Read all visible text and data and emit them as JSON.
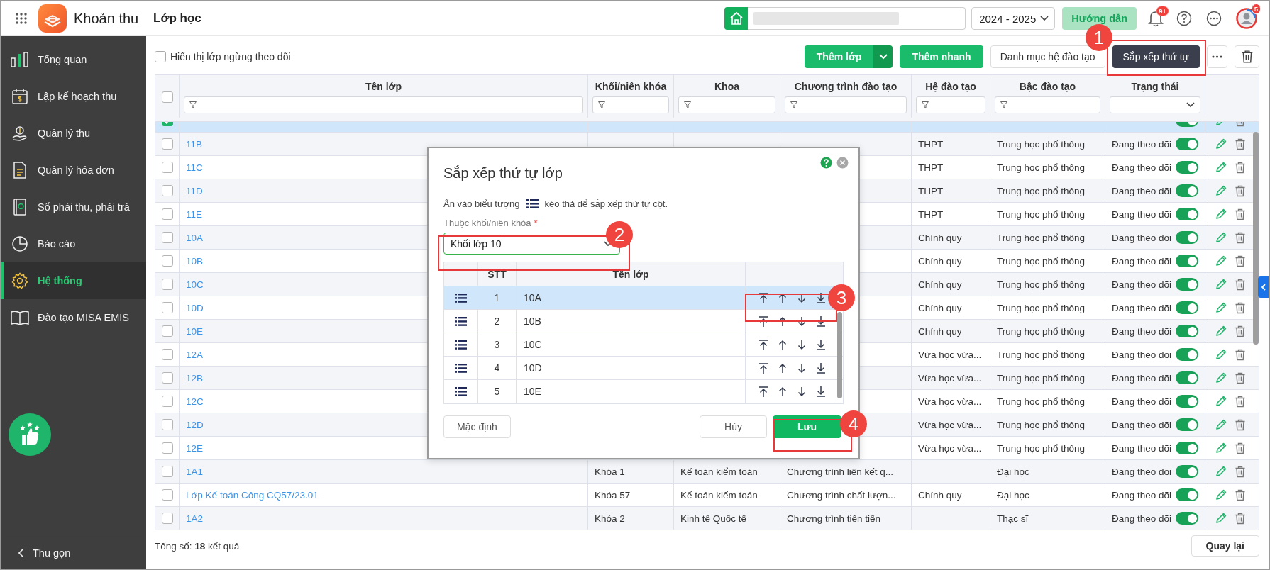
{
  "app": {
    "title": "Khoản thu",
    "page_title": "Lớp học"
  },
  "topbar": {
    "school_year": "2024 - 2025",
    "guide_button": "Hướng dẫn",
    "notification_badge": "9+",
    "avatar_badge": "5"
  },
  "sidebar": {
    "items": [
      {
        "label": "Tổng quan",
        "selected": false
      },
      {
        "label": "Lập kế hoạch thu",
        "selected": false
      },
      {
        "label": "Quản lý thu",
        "selected": false
      },
      {
        "label": "Quản lý hóa đơn",
        "selected": false
      },
      {
        "label": "Sổ phải thu, phải trả",
        "selected": false
      },
      {
        "label": "Báo cáo",
        "selected": false
      },
      {
        "label": "Hệ thống",
        "selected": true
      },
      {
        "label": "Đào tạo MISA EMIS",
        "selected": false
      }
    ],
    "collapse": "Thu gọn"
  },
  "toolbar": {
    "show_inactive": {
      "label": "Hiển thị lớp ngừng theo dõi",
      "checked": false
    },
    "buttons": [
      {
        "label": "Thêm lớp",
        "kind": "split"
      },
      {
        "label": "Thêm nhanh",
        "kind": "primary"
      },
      {
        "label": "Danh mục hệ đào tạo",
        "kind": "outline"
      },
      {
        "label": "Sắp xếp thứ tự",
        "kind": "dark"
      }
    ]
  },
  "table": {
    "columns": [
      {
        "label": "Tên lớp",
        "kind": "text"
      },
      {
        "label": "Khối/niên khóa",
        "kind": "text"
      },
      {
        "label": "Khoa",
        "kind": "text"
      },
      {
        "label": "Chương trình đào tạo",
        "kind": "text"
      },
      {
        "label": "Hệ đào tạo",
        "kind": "text"
      },
      {
        "label": "Bậc đào tạo",
        "kind": "text"
      },
      {
        "label": "Trạng thái",
        "kind": "select"
      }
    ],
    "select_all": {
      "checked": false
    },
    "rows": [
      {
        "kind": "clipped",
        "checked": true,
        "selected": true,
        "active": true
      },
      {
        "kind": "row",
        "name": "11B",
        "system": "THPT",
        "level": "Trung học phổ thông",
        "status": "Đang theo dõi",
        "checked": false,
        "selected": false,
        "active": true
      },
      {
        "kind": "row",
        "name": "11C",
        "system": "THPT",
        "level": "Trung học phổ thông",
        "status": "Đang theo dõi",
        "checked": false,
        "selected": false,
        "active": true
      },
      {
        "kind": "row",
        "name": "11D",
        "system": "THPT",
        "level": "Trung học phổ thông",
        "status": "Đang theo dõi",
        "checked": false,
        "selected": false,
        "active": true
      },
      {
        "kind": "row",
        "name": "11E",
        "system": "THPT",
        "level": "Trung học phổ thông",
        "status": "Đang theo dõi",
        "checked": false,
        "selected": false,
        "active": true
      },
      {
        "kind": "row",
        "name": "10A",
        "system": "Chính quy",
        "level": "Trung học phổ thông",
        "status": "Đang theo dõi",
        "checked": false,
        "selected": false,
        "active": true
      },
      {
        "kind": "row",
        "name": "10B",
        "system": "Chính quy",
        "level": "Trung học phổ thông",
        "status": "Đang theo dõi",
        "checked": false,
        "selected": false,
        "active": true
      },
      {
        "kind": "row",
        "name": "10C",
        "system": "Chính quy",
        "level": "Trung học phổ thông",
        "status": "Đang theo dõi",
        "checked": false,
        "selected": false,
        "active": true
      },
      {
        "kind": "row",
        "name": "10D",
        "system": "Chính quy",
        "level": "Trung học phổ thông",
        "status": "Đang theo dõi",
        "checked": false,
        "selected": false,
        "active": true
      },
      {
        "kind": "row",
        "name": "10E",
        "system": "Chính quy",
        "level": "Trung học phổ thông",
        "status": "Đang theo dõi",
        "checked": false,
        "selected": false,
        "active": true
      },
      {
        "kind": "row",
        "name": "12A",
        "system": "Vừa học vừa...",
        "level": "Trung học phổ thông",
        "status": "Đang theo dõi",
        "checked": false,
        "selected": false,
        "active": true
      },
      {
        "kind": "row",
        "name": "12B",
        "system": "Vừa học vừa...",
        "level": "Trung học phổ thông",
        "status": "Đang theo dõi",
        "checked": false,
        "selected": false,
        "active": true
      },
      {
        "kind": "row",
        "name": "12C",
        "system": "Vừa học vừa...",
        "level": "Trung học phổ thông",
        "status": "Đang theo dõi",
        "checked": false,
        "selected": false,
        "active": true
      },
      {
        "kind": "row",
        "name": "12D",
        "system": "Vừa học vừa...",
        "level": "Trung học phổ thông",
        "status": "Đang theo dõi",
        "checked": false,
        "selected": false,
        "active": true
      },
      {
        "kind": "row",
        "name": "12E",
        "system": "Vừa học vừa...",
        "level": "Trung học phổ thông",
        "status": "Đang theo dõi",
        "checked": false,
        "selected": false,
        "active": true
      },
      {
        "kind": "row",
        "name": "1A1",
        "cohort": "Khóa 1",
        "faculty": "Kế toán kiểm toán",
        "program": "Chương trình liên kết q...",
        "level": "Đại học",
        "status": "Đang theo dõi",
        "checked": false,
        "selected": false,
        "active": true
      },
      {
        "kind": "row",
        "name": "Lớp Kế toán Công CQ57/23.01",
        "cohort": "Khóa 57",
        "faculty": "Kế toán kiểm toán",
        "program": "Chương trình chất lượn...",
        "system": "Chính quy",
        "level": "Đại học",
        "status": "Đang theo dõi",
        "checked": false,
        "selected": false,
        "active": true
      },
      {
        "kind": "row",
        "name": "1A2",
        "cohort": "Khóa 2",
        "faculty": "Kinh tế Quốc tế",
        "program": "Chương trình tiên tiến",
        "level": "Thạc sĩ",
        "status": "Đang theo dõi",
        "checked": false,
        "selected": false,
        "active": true
      }
    ]
  },
  "footer": {
    "total": "Tổng số: **18** kết quả",
    "back_button": "Quay lại"
  },
  "modal": {
    "title": "Sắp xếp thứ tự lớp",
    "hint_before": "Ấn vào biểu tượng",
    "hint_after": "kéo thả để sắp xếp thứ tự cột.",
    "field_label": "Thuộc khối/niên khóa",
    "required_mark": "*",
    "value": "Khối lớp 10",
    "columns": [
      "STT",
      "Tên lớp"
    ],
    "rows": [
      {
        "stt": "1",
        "name": "10A",
        "selected": true
      },
      {
        "stt": "2",
        "name": "10B",
        "selected": false
      },
      {
        "stt": "3",
        "name": "10C",
        "selected": false
      },
      {
        "stt": "4",
        "name": "10D",
        "selected": false
      },
      {
        "stt": "5",
        "name": "10E",
        "selected": false
      }
    ],
    "buttons": [
      {
        "label": "Mặc định",
        "kind": "outline"
      },
      {
        "label": "Hủy",
        "kind": "outline"
      },
      {
        "label": "Lưu",
        "kind": "primary"
      }
    ]
  },
  "callouts": [
    {
      "number": "1"
    },
    {
      "number": "2"
    },
    {
      "number": "3"
    },
    {
      "number": "4"
    }
  ]
}
